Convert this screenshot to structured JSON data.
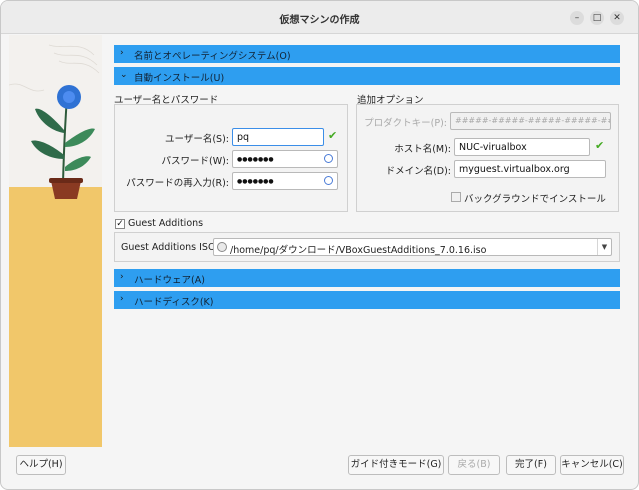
{
  "window": {
    "title": "仮想マシンの作成",
    "minimize_glyph": "–",
    "maximize_glyph": "□",
    "close_glyph": "✕"
  },
  "sections": {
    "name_os": {
      "label": "名前とオペレーティングシステム(O)",
      "chevron": "›"
    },
    "unattended": {
      "label": "自動インストール(U)",
      "chevron": "⌄"
    },
    "hardware": {
      "label": "ハードウェア(A)",
      "chevron": "›"
    },
    "hard_disk": {
      "label": "ハードディスク(K)",
      "chevron": "›"
    }
  },
  "user_group": {
    "title": "ユーザー名とパスワード",
    "username_label": "ユーザー名(S):",
    "username_value": "pq",
    "password_label": "パスワード(W):",
    "password_value": "●●●●●●●",
    "repeat_label": "パスワードの再入力(R):",
    "repeat_value": "●●●●●●●"
  },
  "options_group": {
    "title": "追加オプション",
    "product_key_label": "プロダクトキー(P):",
    "product_key_placeholder": "#####-#####-#####-#####-#####",
    "hostname_label": "ホスト名(M):",
    "hostname_value": "NUC-virualbox",
    "domain_label": "ドメイン名(D):",
    "domain_value": "myguest.virtualbox.org",
    "background_label": "バックグラウンドでインストール",
    "background_checked": false
  },
  "guest_additions": {
    "checkbox_label": "Guest Additions",
    "checked": true,
    "iso_label": "Guest Additions ISO:",
    "iso_value": "/home/pq/ダウンロード/VBoxGuestAdditions_7.0.16.iso"
  },
  "footer": {
    "help_label": "ヘルプ(H)",
    "guided_label": "ガイド付きモード(G)",
    "back_label": "戻る(B)",
    "finish_label": "完了(F)",
    "cancel_label": "キャンセル(C)"
  },
  "colors": {
    "section_bar": "#2e9ef0",
    "sidebar_floor": "#f1c76a",
    "valid_check": "#44aa22"
  }
}
